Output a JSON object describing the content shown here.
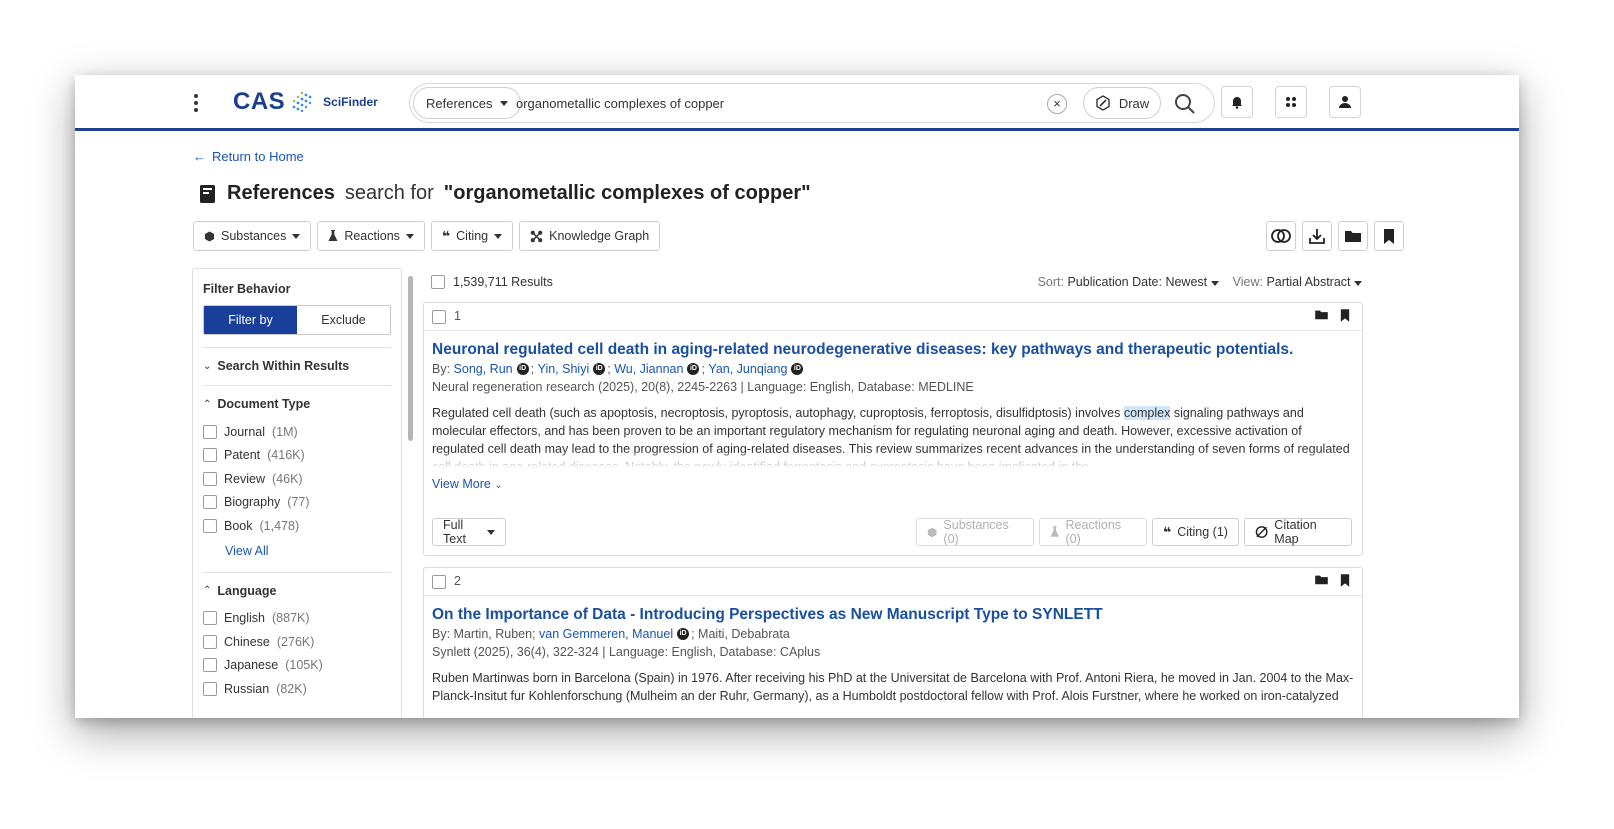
{
  "header": {
    "logo_text": "CAS",
    "product_name": "SciFinder",
    "search_type": "References",
    "search_query": "organometallic complexes of copper",
    "draw_label": "Draw"
  },
  "page": {
    "back_label": "Return to Home",
    "title_type": "References",
    "title_mid": "search for",
    "title_query": "\"organometallic complexes of copper\""
  },
  "toolbar": {
    "substances": "Substances",
    "reactions": "Reactions",
    "citing": "Citing",
    "knowledge_graph": "Knowledge Graph"
  },
  "sidebar": {
    "filter_behavior": "Filter Behavior",
    "filter_by": "Filter by",
    "exclude": "Exclude",
    "search_within": "Search Within Results",
    "doc_type": {
      "title": "Document Type",
      "items": [
        {
          "label": "Journal",
          "count": "(1M)"
        },
        {
          "label": "Patent",
          "count": "(416K)"
        },
        {
          "label": "Review",
          "count": "(46K)"
        },
        {
          "label": "Biography",
          "count": "(77)"
        },
        {
          "label": "Book",
          "count": "(1,478)"
        }
      ],
      "view_all": "View All"
    },
    "language": {
      "title": "Language",
      "items": [
        {
          "label": "English",
          "count": "(887K)"
        },
        {
          "label": "Chinese",
          "count": "(276K)"
        },
        {
          "label": "Japanese",
          "count": "(105K)"
        },
        {
          "label": "Russian",
          "count": "(82K)"
        }
      ]
    }
  },
  "results": {
    "count_label": "1,539,711 Results",
    "sort_label": "Sort:",
    "sort_value": "Publication Date: Newest",
    "view_label": "View:",
    "view_value": "Partial Abstract",
    "items": [
      {
        "num": "1",
        "title": "Neuronal regulated cell death in aging-related neurodegenerative diseases: key pathways and therapeutic potentials.",
        "by": "By:",
        "authors": [
          "Song, Run",
          "Yin, Shiyi",
          "Wu, Jiannan",
          "Yan, Junqiang"
        ],
        "source": "Neural regeneration research (2025), 20(8), 2245-2263 | Language: English, Database: MEDLINE",
        "abstract_pre": "Regulated cell death (such as apoptosis, necroptosis, pyroptosis, autophagy, cuproptosis, ferroptosis, disulfidptosis) involves ",
        "abstract_hl": "complex",
        "abstract_post": " signaling pathways and molecular effectors, and has been proven to be an important regulatory mechanism for regulating neuronal aging and death. However, excessive activation of regulated cell death may lead to the progression of aging-related diseases. This review summarizes recent advances in the understanding of seven forms of regulated cell death in age-related diseases. Notably, the newly identified ferroptosis and cuproptosis have been implicated in the ...",
        "view_more": "View More",
        "full_text": "Full Text",
        "substances": "Substances (0)",
        "reactions": "Reactions (0)",
        "citing": "Citing (1)",
        "citation_map": "Citation Map"
      },
      {
        "num": "2",
        "title": "On the Importance of Data - Introducing Perspectives as New Manuscript Type to SYNLETT",
        "by": "By:",
        "author_1": "Martin, Ruben;",
        "author_2": "van Gemmeren, Manuel",
        "author_3": "; Maiti, Debabrata",
        "source": "Synlett (2025), 36(4), 322-324 | Language: English, Database: CAplus",
        "abstract": "Ruben Martinwas born in Barcelona (Spain) in 1976. After receiving his PhD at the Universitat de Barcelona with Prof. Antoni Riera, he moved in Jan. 2004 to the Max-Planck-Insitut fur Kohlenforschung (Mulheim an der Ruhr, Germany), as a Humboldt postdoctoral fellow with Prof. Alois Furstner, where he worked on iron-catalyzed"
      }
    ]
  },
  "colors": {
    "brand_blue": "#1a3f8e",
    "link_blue": "#1a55b0",
    "highlight": "#cfe6fb"
  }
}
